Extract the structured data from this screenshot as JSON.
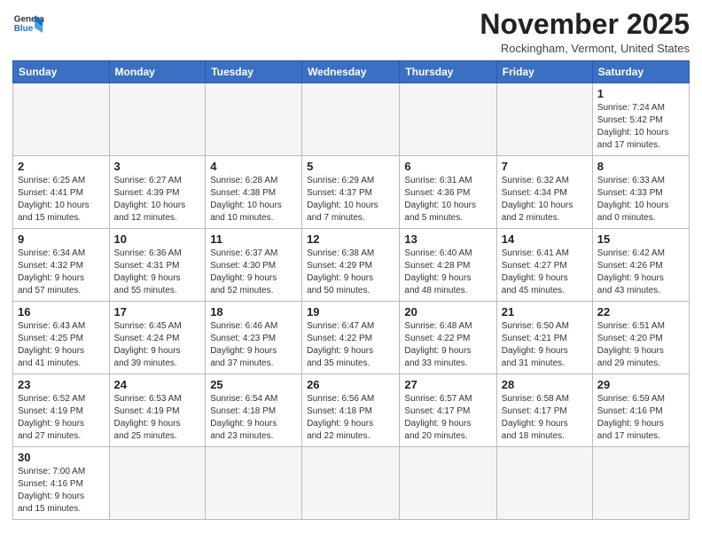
{
  "header": {
    "logo_general": "General",
    "logo_blue": "Blue",
    "month_title": "November 2025",
    "location": "Rockingham, Vermont, United States"
  },
  "weekdays": [
    "Sunday",
    "Monday",
    "Tuesday",
    "Wednesday",
    "Thursday",
    "Friday",
    "Saturday"
  ],
  "weeks": [
    [
      {
        "day": "",
        "info": ""
      },
      {
        "day": "",
        "info": ""
      },
      {
        "day": "",
        "info": ""
      },
      {
        "day": "",
        "info": ""
      },
      {
        "day": "",
        "info": ""
      },
      {
        "day": "",
        "info": ""
      },
      {
        "day": "1",
        "info": "Sunrise: 7:24 AM\nSunset: 5:42 PM\nDaylight: 10 hours\nand 17 minutes."
      }
    ],
    [
      {
        "day": "2",
        "info": "Sunrise: 6:25 AM\nSunset: 4:41 PM\nDaylight: 10 hours\nand 15 minutes."
      },
      {
        "day": "3",
        "info": "Sunrise: 6:27 AM\nSunset: 4:39 PM\nDaylight: 10 hours\nand 12 minutes."
      },
      {
        "day": "4",
        "info": "Sunrise: 6:28 AM\nSunset: 4:38 PM\nDaylight: 10 hours\nand 10 minutes."
      },
      {
        "day": "5",
        "info": "Sunrise: 6:29 AM\nSunset: 4:37 PM\nDaylight: 10 hours\nand 7 minutes."
      },
      {
        "day": "6",
        "info": "Sunrise: 6:31 AM\nSunset: 4:36 PM\nDaylight: 10 hours\nand 5 minutes."
      },
      {
        "day": "7",
        "info": "Sunrise: 6:32 AM\nSunset: 4:34 PM\nDaylight: 10 hours\nand 2 minutes."
      },
      {
        "day": "8",
        "info": "Sunrise: 6:33 AM\nSunset: 4:33 PM\nDaylight: 10 hours\nand 0 minutes."
      }
    ],
    [
      {
        "day": "9",
        "info": "Sunrise: 6:34 AM\nSunset: 4:32 PM\nDaylight: 9 hours\nand 57 minutes."
      },
      {
        "day": "10",
        "info": "Sunrise: 6:36 AM\nSunset: 4:31 PM\nDaylight: 9 hours\nand 55 minutes."
      },
      {
        "day": "11",
        "info": "Sunrise: 6:37 AM\nSunset: 4:30 PM\nDaylight: 9 hours\nand 52 minutes."
      },
      {
        "day": "12",
        "info": "Sunrise: 6:38 AM\nSunset: 4:29 PM\nDaylight: 9 hours\nand 50 minutes."
      },
      {
        "day": "13",
        "info": "Sunrise: 6:40 AM\nSunset: 4:28 PM\nDaylight: 9 hours\nand 48 minutes."
      },
      {
        "day": "14",
        "info": "Sunrise: 6:41 AM\nSunset: 4:27 PM\nDaylight: 9 hours\nand 45 minutes."
      },
      {
        "day": "15",
        "info": "Sunrise: 6:42 AM\nSunset: 4:26 PM\nDaylight: 9 hours\nand 43 minutes."
      }
    ],
    [
      {
        "day": "16",
        "info": "Sunrise: 6:43 AM\nSunset: 4:25 PM\nDaylight: 9 hours\nand 41 minutes."
      },
      {
        "day": "17",
        "info": "Sunrise: 6:45 AM\nSunset: 4:24 PM\nDaylight: 9 hours\nand 39 minutes."
      },
      {
        "day": "18",
        "info": "Sunrise: 6:46 AM\nSunset: 4:23 PM\nDaylight: 9 hours\nand 37 minutes."
      },
      {
        "day": "19",
        "info": "Sunrise: 6:47 AM\nSunset: 4:22 PM\nDaylight: 9 hours\nand 35 minutes."
      },
      {
        "day": "20",
        "info": "Sunrise: 6:48 AM\nSunset: 4:22 PM\nDaylight: 9 hours\nand 33 minutes."
      },
      {
        "day": "21",
        "info": "Sunrise: 6:50 AM\nSunset: 4:21 PM\nDaylight: 9 hours\nand 31 minutes."
      },
      {
        "day": "22",
        "info": "Sunrise: 6:51 AM\nSunset: 4:20 PM\nDaylight: 9 hours\nand 29 minutes."
      }
    ],
    [
      {
        "day": "23",
        "info": "Sunrise: 6:52 AM\nSunset: 4:19 PM\nDaylight: 9 hours\nand 27 minutes."
      },
      {
        "day": "24",
        "info": "Sunrise: 6:53 AM\nSunset: 4:19 PM\nDaylight: 9 hours\nand 25 minutes."
      },
      {
        "day": "25",
        "info": "Sunrise: 6:54 AM\nSunset: 4:18 PM\nDaylight: 9 hours\nand 23 minutes."
      },
      {
        "day": "26",
        "info": "Sunrise: 6:56 AM\nSunset: 4:18 PM\nDaylight: 9 hours\nand 22 minutes."
      },
      {
        "day": "27",
        "info": "Sunrise: 6:57 AM\nSunset: 4:17 PM\nDaylight: 9 hours\nand 20 minutes."
      },
      {
        "day": "28",
        "info": "Sunrise: 6:58 AM\nSunset: 4:17 PM\nDaylight: 9 hours\nand 18 minutes."
      },
      {
        "day": "29",
        "info": "Sunrise: 6:59 AM\nSunset: 4:16 PM\nDaylight: 9 hours\nand 17 minutes."
      }
    ],
    [
      {
        "day": "30",
        "info": "Sunrise: 7:00 AM\nSunset: 4:16 PM\nDaylight: 9 hours\nand 15 minutes."
      },
      {
        "day": "",
        "info": ""
      },
      {
        "day": "",
        "info": ""
      },
      {
        "day": "",
        "info": ""
      },
      {
        "day": "",
        "info": ""
      },
      {
        "day": "",
        "info": ""
      },
      {
        "day": "",
        "info": ""
      }
    ]
  ]
}
